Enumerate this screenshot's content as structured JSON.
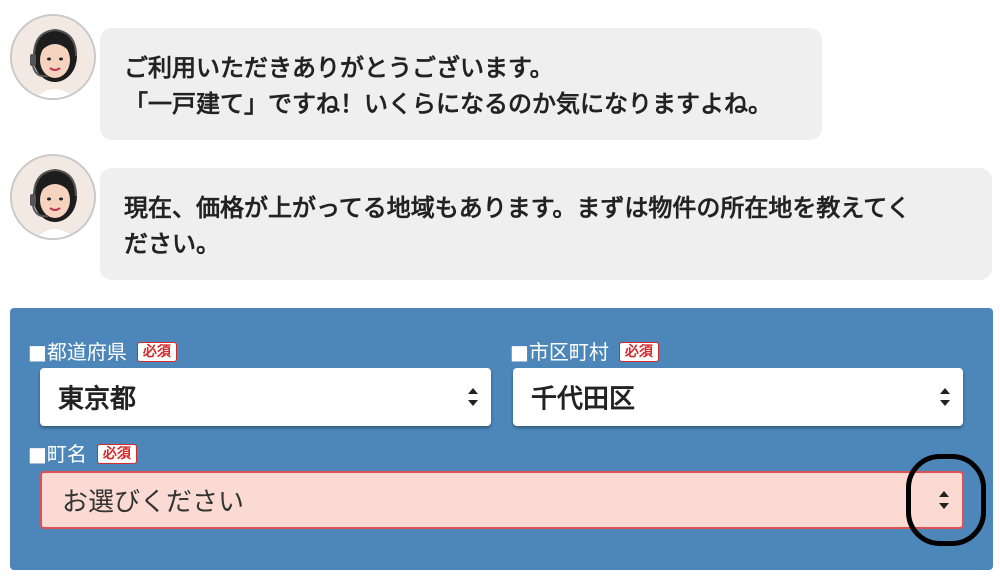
{
  "chat": [
    {
      "lines": [
        "ご利用いただきありがとうございます。",
        "「一戸建て」ですね！いくらになるのか気になりますよね。"
      ]
    },
    {
      "lines": [
        "現在、価格が上がってる地域もあります。まずは物件の所在地を教えてく",
        "ださい。"
      ]
    }
  ],
  "form": {
    "prefecture": {
      "label": "■都道府県",
      "badge": "必須",
      "value": "東京都"
    },
    "city": {
      "label": "■市区町村",
      "badge": "必須",
      "value": "千代田区"
    },
    "town": {
      "label": "■町名",
      "badge": "必須",
      "placeholder": "お選びください"
    }
  },
  "colors": {
    "panel": "#4d87ba",
    "bubble": "#efefef",
    "required_badge": "#d42a2a",
    "error_field_bg": "#fadad2",
    "error_field_border": "#e05050"
  },
  "icons": [
    "operator-avatar",
    "select-updown-icon"
  ]
}
